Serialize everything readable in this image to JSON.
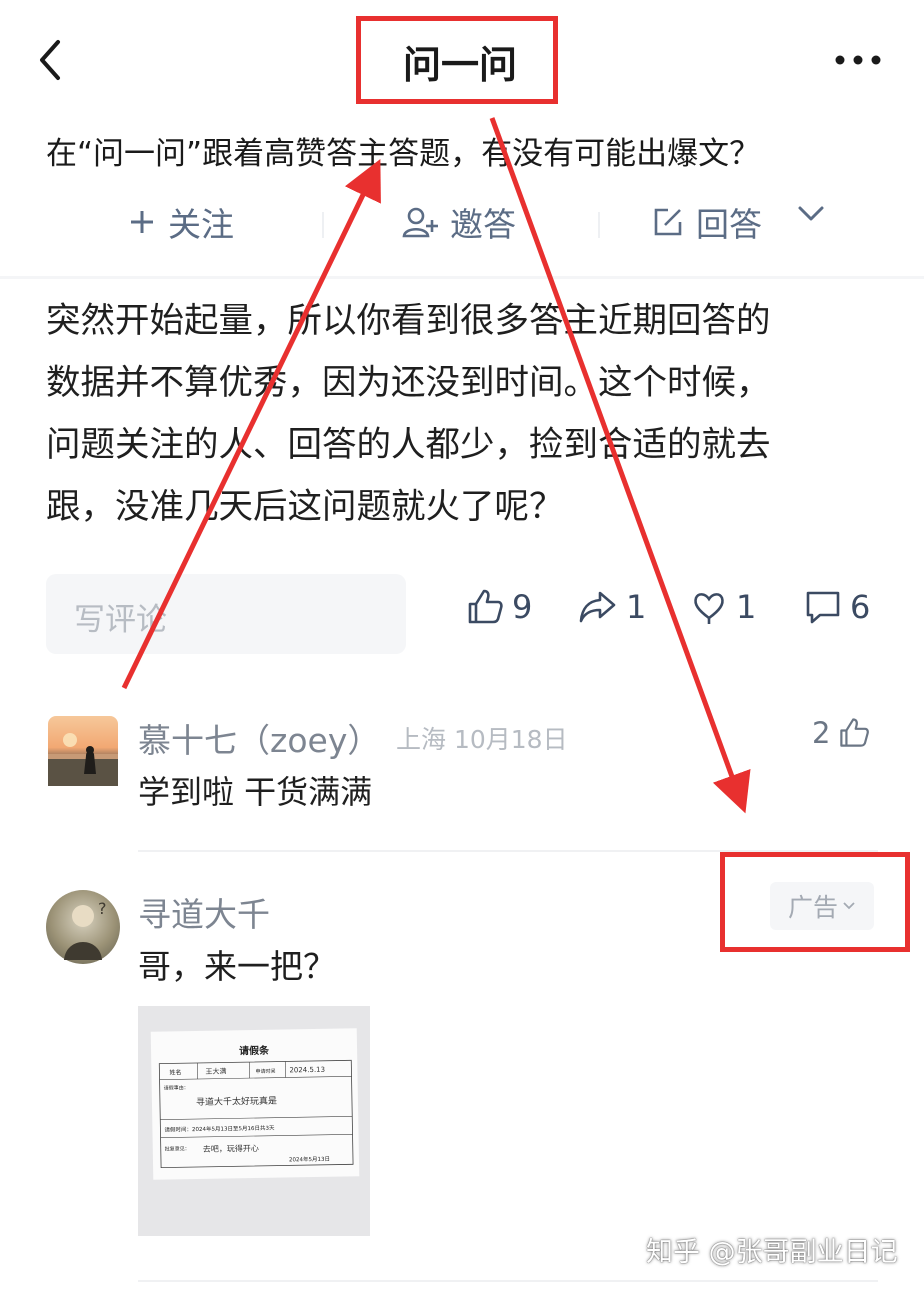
{
  "header": {
    "title": "问一问"
  },
  "question": {
    "text": "在“问一问”跟着高赞答主答题，有没有可能出爆文？"
  },
  "actions": {
    "follow": "关注",
    "invite": "邀答",
    "answer": "回答"
  },
  "answer": {
    "lines": [
      "突然开始起量，所以你看到很多答主近期回答的",
      "数据并不算优秀，因为还没到时间。这个时候，",
      "问题关注的人、回答的人都少，捡到合适的就去",
      "跟，没准几天后这问题就火了呢？"
    ]
  },
  "comment_input": {
    "placeholder": "写评论"
  },
  "stats": {
    "likes": "9",
    "shares": "1",
    "favorites": "1",
    "comments": "6"
  },
  "comments": [
    {
      "name": "慕十七（zoey）",
      "location": "上海",
      "date": "10月18日",
      "likes": "2",
      "text": "学到啦  干货满满"
    },
    {
      "name": "寻道大千",
      "badge": "广告",
      "text": "哥，来一把？"
    }
  ],
  "attached_image": {
    "heading": "请假条",
    "name_label": "姓名",
    "name_value": "王大满",
    "time_label": "申请时间",
    "time_value": "2024.5.13",
    "reason_label": "请假事由：",
    "reason_value": "寻道大千太好玩真是",
    "period_text": "请假时间：2024年5月13日至5月16日共3天",
    "approval_label": "批复意见：",
    "approval_value": "去吧，玩得开心",
    "approval_date": "2024年5月13日"
  },
  "watermark": "知乎 @张哥副业日记",
  "colors": {
    "accent_red": "#e8302f",
    "action_blue": "#5b6c85",
    "muted": "#7d8591"
  }
}
